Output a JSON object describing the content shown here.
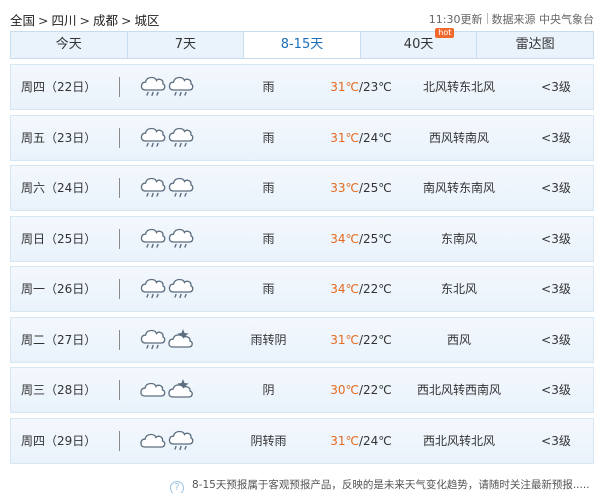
{
  "breadcrumb": [
    "全国",
    "四川",
    "成都",
    "城区"
  ],
  "breadcrumb_sep": ">",
  "meta": {
    "update": "11:30更新",
    "source": "数据来源 中央气象台"
  },
  "tabs": [
    {
      "label": "今天",
      "active": false
    },
    {
      "label": "7天",
      "active": false
    },
    {
      "label": "8-15天",
      "active": true
    },
    {
      "label": "40天",
      "active": false,
      "badge": "hot"
    },
    {
      "label": "雷达图",
      "active": false
    }
  ],
  "forecast": [
    {
      "day": "周四（22日）",
      "icons": [
        "rain-cloud-icon",
        "rain-cloud-icon"
      ],
      "condition": "雨",
      "high": "31℃",
      "low": "/23℃",
      "wind": "北风转东北风",
      "level": "<3级"
    },
    {
      "day": "周五（23日）",
      "icons": [
        "rain-cloud-icon",
        "rain-cloud-icon"
      ],
      "condition": "雨",
      "high": "31℃",
      "low": "/24℃",
      "wind": "西风转南风",
      "level": "<3级"
    },
    {
      "day": "周六（24日）",
      "icons": [
        "rain-cloud-icon",
        "rain-cloud-icon"
      ],
      "condition": "雨",
      "high": "33℃",
      "low": "/25℃",
      "wind": "南风转东南风",
      "level": "<3级"
    },
    {
      "day": "周日（25日）",
      "icons": [
        "rain-cloud-icon",
        "rain-cloud-icon"
      ],
      "condition": "雨",
      "high": "34℃",
      "low": "/25℃",
      "wind": "东南风",
      "level": "<3级"
    },
    {
      "day": "周一（26日）",
      "icons": [
        "rain-cloud-icon",
        "rain-cloud-icon"
      ],
      "condition": "雨",
      "high": "34℃",
      "low": "/22℃",
      "wind": "东北风",
      "level": "<3级"
    },
    {
      "day": "周二（27日）",
      "icons": [
        "rain-cloud-icon",
        "cloudy-night-icon"
      ],
      "condition": "雨转阴",
      "high": "31℃",
      "low": "/22℃",
      "wind": "西风",
      "level": "<3级"
    },
    {
      "day": "周三（28日）",
      "icons": [
        "cloud-icon",
        "cloudy-night-icon"
      ],
      "condition": "阴",
      "high": "30℃",
      "low": "/22℃",
      "wind": "西北风转西南风",
      "level": "<3级"
    },
    {
      "day": "周四（29日）",
      "icons": [
        "cloud-icon",
        "rain-cloud-icon"
      ],
      "condition": "阴转雨",
      "high": "31℃",
      "low": "/24℃",
      "wind": "西北风转北风",
      "level": "<3级"
    }
  ],
  "footer": {
    "help_icon": "?",
    "text": "8-15天预报属于客观预报产品，反映的是未来天气变化趋势，请随时关注最新预报....."
  },
  "colors": {
    "accent": "#1b6fb9",
    "high_temp": "#e56a1f",
    "hot_badge": "#f06a2f",
    "row_bg": "#eef5fc"
  }
}
